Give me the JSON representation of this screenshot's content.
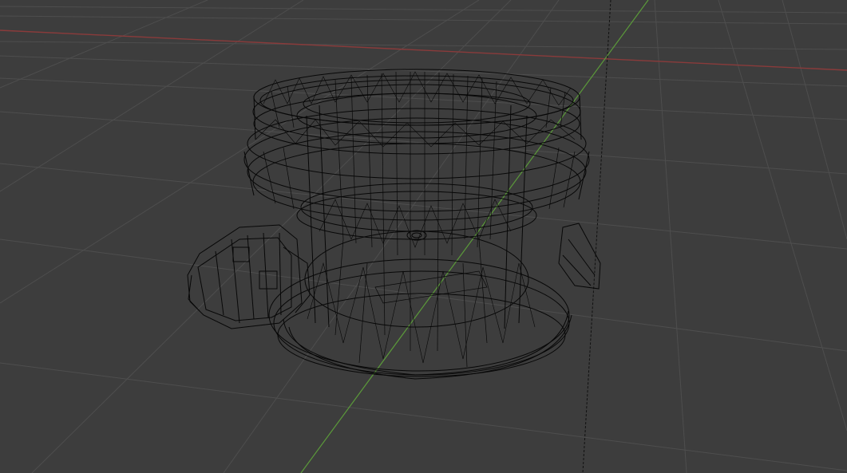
{
  "viewport": {
    "background_color": "#3d3d3d",
    "grid_line_color": "#4e4e4e",
    "x_axis_color": "#8a3b3b",
    "y_axis_color": "#5b9a3a",
    "wire_color": "#050505",
    "mode": "wireframe",
    "object": "mesh-wireframe"
  }
}
